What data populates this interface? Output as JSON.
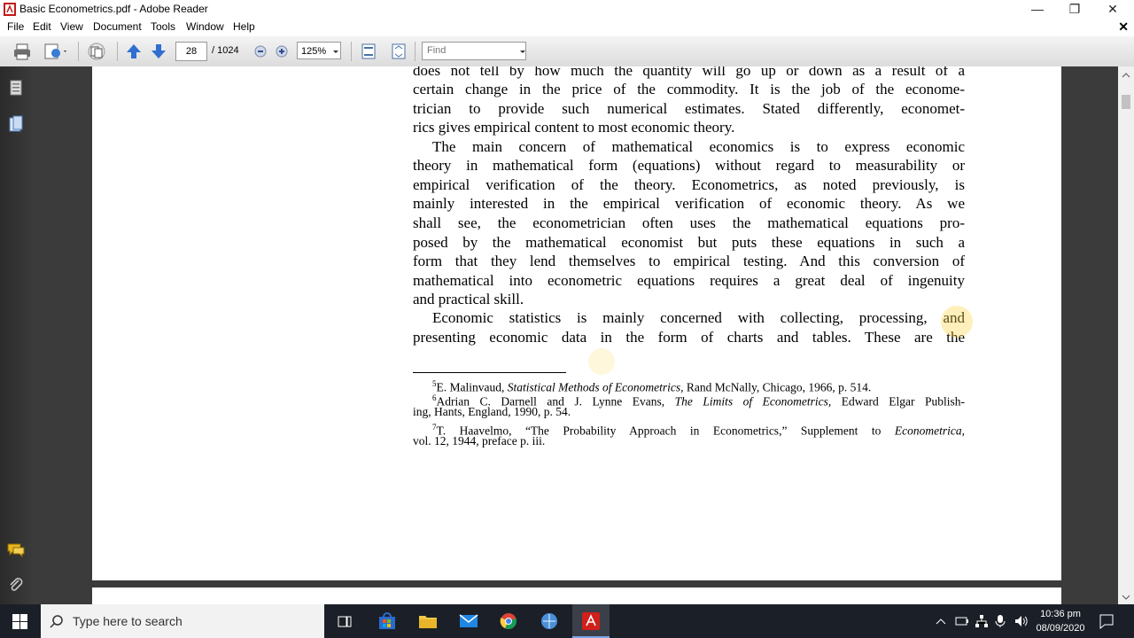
{
  "window": {
    "title": "Basic Econometrics.pdf - Adobe Reader",
    "controls": {
      "minimize": "—",
      "restore": "❐",
      "close": "✕"
    }
  },
  "menubar": {
    "items": [
      "File",
      "Edit",
      "View",
      "Document",
      "Tools",
      "Window",
      "Help"
    ],
    "doc_close": "✕"
  },
  "toolbar": {
    "page_number": "28",
    "page_total": "/ 1024",
    "zoom": "125%",
    "find_placeholder": "Find"
  },
  "document": {
    "lines": [
      "does not tell by how much the quantity will go up or down as a result of a",
      "certain change in the price of the commodity. It is the job of the econome-",
      "trician to provide such numerical estimates. Stated differently, economet-",
      "rics gives empirical content to most economic theory.",
      "The main concern of mathematical economics is to express economic",
      "theory in mathematical form (equations) without regard to measurability or",
      "empirical verification of the theory. Econometrics, as noted previously, is",
      "mainly interested in the empirical verification of economic theory. As we",
      "shall see, the econometrician often uses the mathematical equations pro-",
      "posed by the mathematical economist but puts these equations in such a",
      "form that they lend themselves to empirical testing. And this conversion of",
      "mathematical into econometric equations requires a great deal of ingenuity",
      "and practical skill.",
      "Economic statistics is mainly concerned with collecting, processing, and",
      "presenting economic data in the form of charts and tables. These are the"
    ],
    "footnotes": {
      "fn5": {
        "mark": "5",
        "author": "E. Malinvaud, ",
        "title": "Statistical Methods of Econometrics,",
        "rest": " Rand McNally, Chicago, 1966, p. 514."
      },
      "fn6": {
        "mark": "6",
        "author": "Adrian C. Darnell and J. Lynne Evans, ",
        "title": "The Limits of Econometrics,",
        "rest": " Edward Elgar Publish-",
        "cont": "ing, Hants, England, 1990, p. 54."
      },
      "fn7": {
        "mark": "7",
        "author": "T. Haavelmo, “The Probability Approach in Econometrics,” Supplement to ",
        "title": "Econometrica,",
        "cont": "vol. 12, 1944, preface p. iii."
      }
    }
  },
  "taskbar": {
    "search_placeholder": "Type here to search",
    "time": "10:36 pm",
    "date": "08/09/2020"
  },
  "colors": {
    "taskbar": "#1b1f27",
    "viewer_bg": "#3b3b3b",
    "acrobat_red": "#d0201a"
  }
}
